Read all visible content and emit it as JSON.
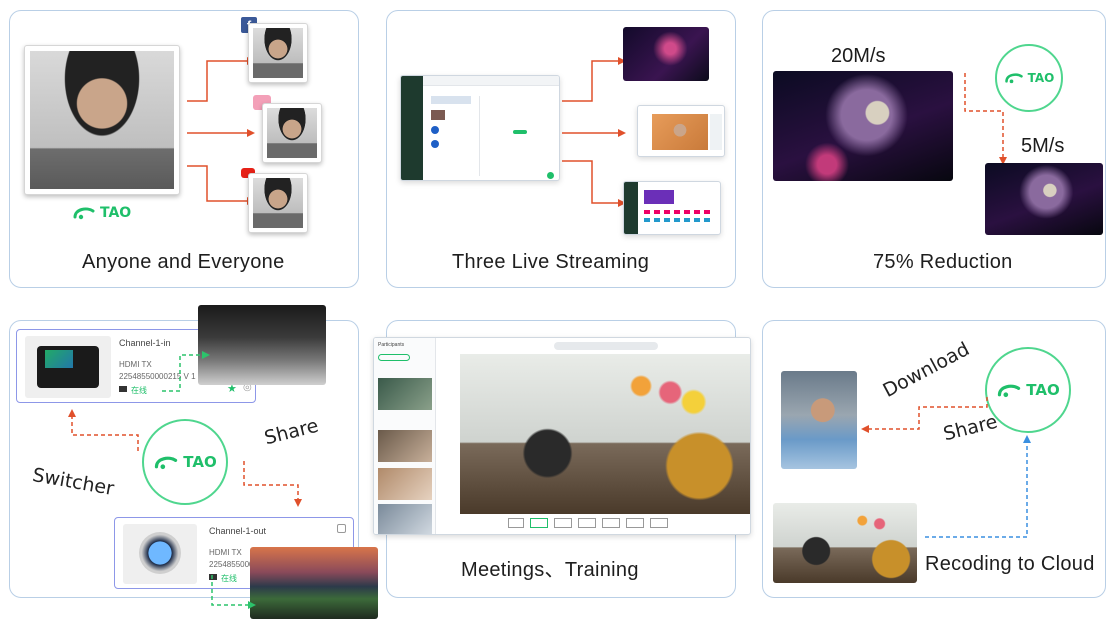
{
  "cards": {
    "anyone": {
      "caption": "Anyone and Everyone"
    },
    "three": {
      "caption": "Three Live Streaming"
    },
    "reduction": {
      "caption": "75% Reduction",
      "speed_high": "20M/s",
      "speed_low": "5M/s"
    },
    "switcher": {
      "switcher_label": "Switcher",
      "share_label": "Share",
      "channel_in": {
        "title": "Channel-1-in",
        "model": "HDMI TX",
        "serial": "22548550000215  V 1",
        "status": "在线"
      },
      "channel_out": {
        "title": "Channel-1-out",
        "model": "HDMI TX",
        "serial": "22548550000",
        "status": "在线"
      }
    },
    "meetings": {
      "caption": "Meetings、Training",
      "sidebar_title": "Participants"
    },
    "cloud": {
      "caption": "Recoding to Cloud",
      "download_label": "Download",
      "share_label": "Share"
    }
  },
  "brand": {
    "name": "TAO",
    "color": "#1fbf6a"
  },
  "platform_icons": [
    "facebook-icon",
    "bilibili-icon",
    "youtube-icon"
  ],
  "colors": {
    "card_border": "#b9cfe6",
    "arrow_red": "#e0502b",
    "arrow_blue": "#3a8fe0",
    "green": "#1fbf6a"
  }
}
